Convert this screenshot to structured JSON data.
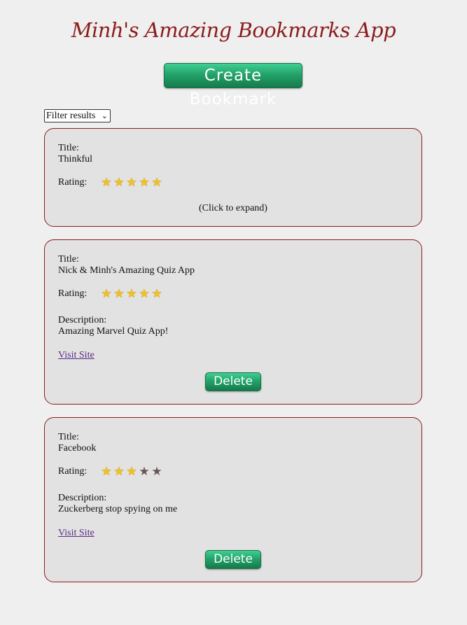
{
  "app": {
    "title": "Minh's Amazing Bookmarks App"
  },
  "toolbar": {
    "create_label": "Create Bookmark"
  },
  "filter": {
    "selected": "Filter results",
    "arrow": "⌄"
  },
  "labels": {
    "title": "Title:",
    "rating": "Rating:",
    "description": "Description:",
    "visit": "Visit Site",
    "expand": "(Click to expand)",
    "delete": "Delete"
  },
  "bookmarks": [
    {
      "title": "Thinkful",
      "rating": 5,
      "expanded": false
    },
    {
      "title": "Nick & Minh's Amazing Quiz App",
      "rating": 5,
      "expanded": true,
      "description": "Amazing Marvel Quiz App!"
    },
    {
      "title": "Facebook",
      "rating": 3,
      "expanded": true,
      "description": "Zuckerberg stop spying on me"
    }
  ],
  "colors": {
    "accent": "#8b1d1d",
    "button_green": "#23a36a",
    "star_on": "#f3c11b",
    "star_off": "#6b5454",
    "card_bg": "#e2e2e2",
    "page_bg": "#efefef"
  }
}
